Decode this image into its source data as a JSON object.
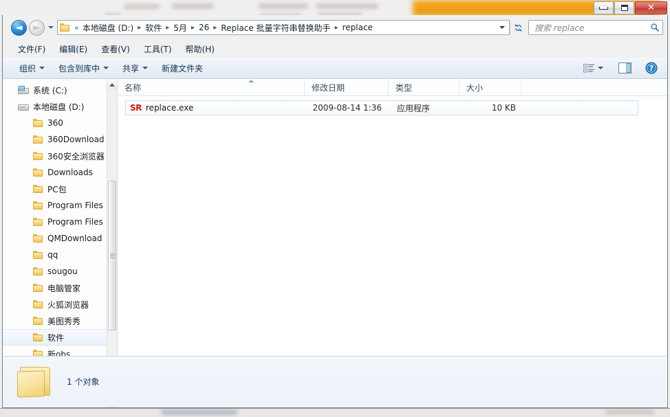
{
  "window": {
    "controls": {
      "minimize_label": "最小化",
      "maximize_label": "最大化",
      "close_label": "关闭",
      "close_glyph": "✕"
    }
  },
  "nav_bar": {
    "back_label": "后退",
    "back_glyph": "◄",
    "forward_label": "前进",
    "forward_glyph": "►",
    "history_label": "最近访问的位置",
    "breadcrumb_overflow": "«",
    "breadcrumb": [
      "本地磁盘 (D:)",
      "软件",
      "5月",
      "26",
      "Replace 批量字符串替换助手",
      "replace"
    ],
    "separator": "▸",
    "refresh_label": "刷新",
    "search": {
      "placeholder": "搜索 replace",
      "value": ""
    }
  },
  "menu_bar": {
    "items": [
      "文件(F)",
      "编辑(E)",
      "查看(V)",
      "工具(T)",
      "帮助(H)"
    ]
  },
  "toolbar": {
    "organize_label": "组织",
    "include_in_library_label": "包含到库中",
    "share_label": "共享",
    "new_folder_label": "新建文件夹",
    "view_mode_label": "更改您的视图",
    "preview_pane_label": "显示预览窗格",
    "help_label": "帮助",
    "help_glyph": "?"
  },
  "sidebar": {
    "items": [
      {
        "label": "系统 (C:)",
        "icon": "system-drive-icon",
        "depth": 1,
        "selected": false
      },
      {
        "label": "本地磁盘 (D:)",
        "icon": "drive-icon",
        "depth": 1,
        "selected": false
      },
      {
        "label": "360",
        "icon": "folder-icon",
        "depth": 2,
        "selected": false
      },
      {
        "label": "360Download",
        "icon": "folder-icon",
        "depth": 2,
        "selected": false
      },
      {
        "label": "360安全浏览器",
        "icon": "folder-icon",
        "depth": 2,
        "selected": false
      },
      {
        "label": "Downloads",
        "icon": "folder-icon",
        "depth": 2,
        "selected": false
      },
      {
        "label": "PC包",
        "icon": "folder-icon",
        "depth": 2,
        "selected": false
      },
      {
        "label": "Program Files",
        "icon": "folder-icon",
        "depth": 2,
        "selected": false
      },
      {
        "label": "Program Files",
        "icon": "folder-icon",
        "depth": 2,
        "selected": false
      },
      {
        "label": "QMDownload",
        "icon": "folder-icon",
        "depth": 2,
        "selected": false
      },
      {
        "label": "qq",
        "icon": "folder-icon",
        "depth": 2,
        "selected": false
      },
      {
        "label": "sougou",
        "icon": "folder-icon",
        "depth": 2,
        "selected": false
      },
      {
        "label": "电脑管家",
        "icon": "folder-icon",
        "depth": 2,
        "selected": false
      },
      {
        "label": "火狐浏览器",
        "icon": "folder-icon",
        "depth": 2,
        "selected": false
      },
      {
        "label": "美图秀秀",
        "icon": "folder-icon",
        "depth": 2,
        "selected": false
      },
      {
        "label": "软件",
        "icon": "folder-icon",
        "depth": 2,
        "selected": true
      },
      {
        "label": "新obs",
        "icon": "folder-icon",
        "depth": 2,
        "selected": false
      }
    ]
  },
  "file_list": {
    "columns": [
      {
        "key": "name",
        "label": "名称",
        "sorted": "asc"
      },
      {
        "key": "date",
        "label": "修改日期",
        "sorted": ""
      },
      {
        "key": "type",
        "label": "类型",
        "sorted": ""
      },
      {
        "key": "size",
        "label": "大小",
        "sorted": ""
      }
    ],
    "rows": [
      {
        "icon": "sr-exe-icon",
        "icon_text": "SR",
        "name": "replace.exe",
        "date": "2009-08-14 1:36",
        "type": "应用程序",
        "size": "10 KB"
      }
    ]
  },
  "details_pane": {
    "item_count_text": "1 个对象",
    "folder_icon_label": "文件夹"
  },
  "colors": {
    "accent_blue": "#2d8fd8",
    "selection_border": "#cfdce8",
    "exe_icon_red": "#d01818",
    "title_accent_orange": "#efa016",
    "close_red": "#bf3a31"
  }
}
